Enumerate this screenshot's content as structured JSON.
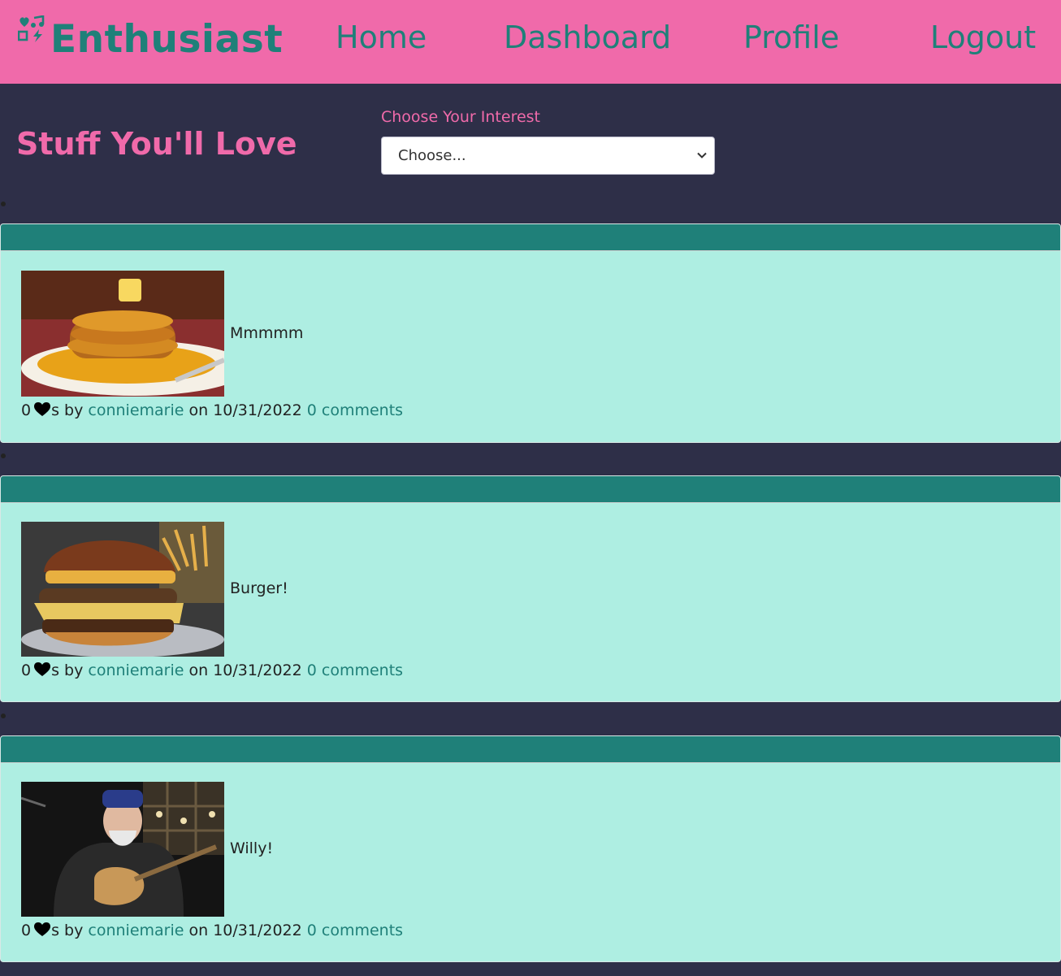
{
  "navbar": {
    "brand": "Enthusiast",
    "links": [
      "Home",
      "Dashboard",
      "Profile",
      "Logout"
    ]
  },
  "page": {
    "title": "Stuff You'll Love",
    "interest_label": "Choose Your Interest",
    "interest_selected": "Choose..."
  },
  "posts": [
    {
      "text": "Mmmmm",
      "likes": "0",
      "likes_suffix": "s by",
      "author": "conniemarie",
      "on": "on",
      "date": "10/31/2022",
      "comments": "0 comments",
      "image": "pancakes"
    },
    {
      "text": "Burger!",
      "likes": "0",
      "likes_suffix": "s by",
      "author": "conniemarie",
      "on": "on",
      "date": "10/31/2022",
      "comments": "0 comments",
      "image": "burger"
    },
    {
      "text": "Willy!",
      "likes": "0",
      "likes_suffix": "s by",
      "author": "conniemarie",
      "on": "on",
      "date": "10/31/2022",
      "comments": "0 comments",
      "image": "musician"
    }
  ],
  "colors": {
    "navbar": "#f06aaa",
    "accent": "#1f8079",
    "background": "#2e2f48",
    "card": "#aeeee2"
  }
}
